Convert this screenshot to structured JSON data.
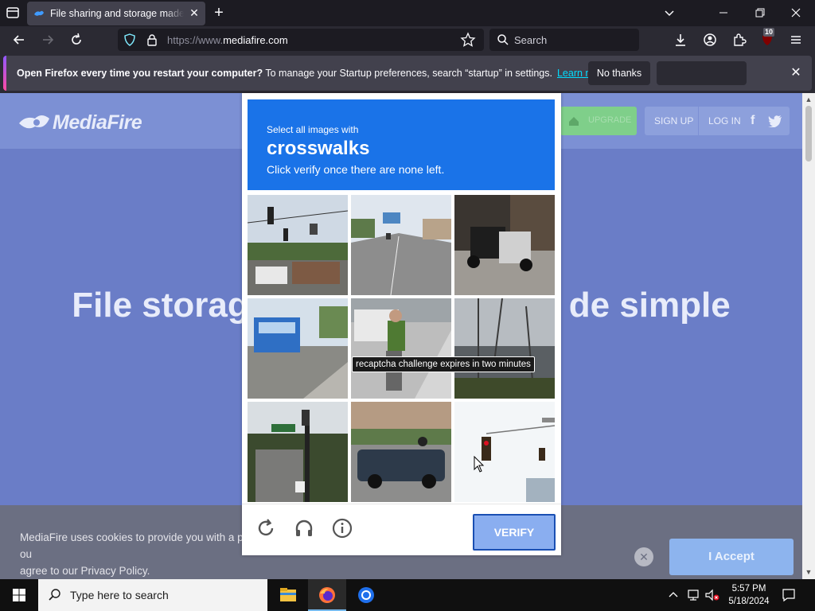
{
  "browser": {
    "tab": {
      "title": "File sharing and storage made simple"
    },
    "url": {
      "scheme": "https://www.",
      "domain": "mediafire.com"
    },
    "search_placeholder": "Search",
    "extension_badge": "10"
  },
  "notification": {
    "bold_text": "Open Firefox every time you restart your computer?",
    "text": " To manage your Startup preferences, search “startup” in settings.",
    "link": "Learn more",
    "no_thanks": "No thanks"
  },
  "site": {
    "logo": "MediaFire",
    "upgrade": "UPGRADE",
    "sign_up": "SIGN UP",
    "log_in": "LOG IN",
    "hero_left": "File storag",
    "hero_right": "de simple",
    "cookie_line1": "MediaFire uses cookies to provide you with a p",
    "cookie_line1_tail": "ou",
    "cookie_line2": "agree to our Privacy Policy.",
    "accept": "I Accept"
  },
  "captcha": {
    "select_text": "Select all images with",
    "target": "crosswalks",
    "instruction": "Click verify once there are none left.",
    "tooltip": "recaptcha challenge expires in two minutes",
    "verify": "VERIFY"
  },
  "taskbar": {
    "search_placeholder": "Type here to search",
    "time": "5:57 PM",
    "date": "5/18/2024"
  },
  "colors": {
    "captcha_blue": "#1a73e8",
    "page_overlay": "#6a7dc7",
    "accept_button": "#8db4ee"
  }
}
